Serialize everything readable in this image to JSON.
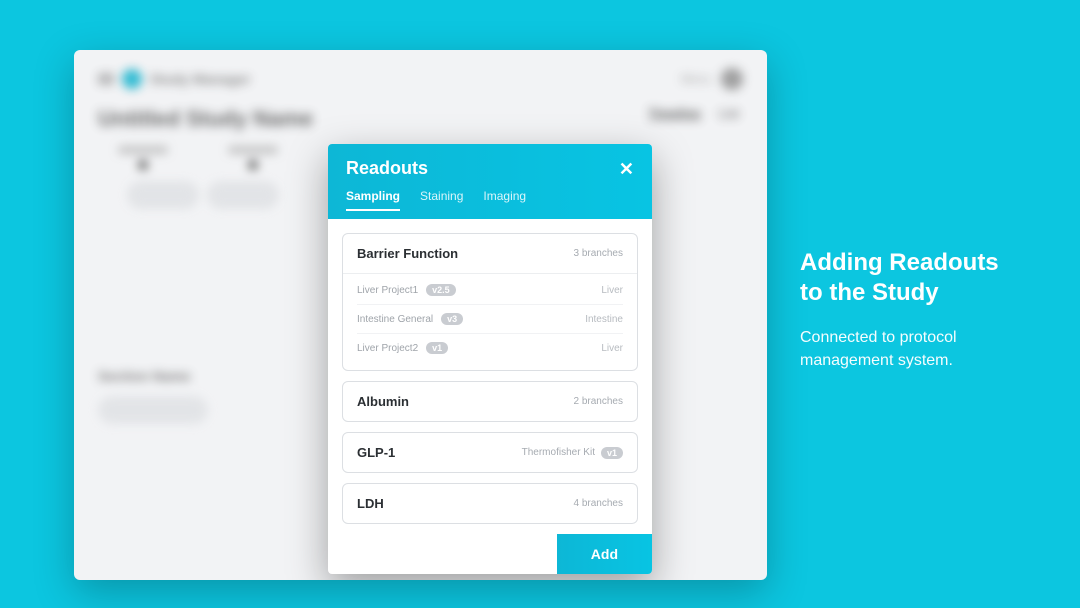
{
  "bg": {
    "app_title": "Study Manager",
    "menu_label": "Menu",
    "h1": "Untitled Study Name",
    "tab_active": "Timeline",
    "tab_other": "List",
    "section_a": "Section Name",
    "section_b": "Start Date"
  },
  "modal": {
    "title": "Readouts",
    "tabs": {
      "sampling": "Sampling",
      "staining": "Staining",
      "imaging": "Imaging"
    },
    "items": [
      {
        "name": "Barrier Function",
        "meta": "3 branches",
        "expanded": true,
        "branches": [
          {
            "name": "Liver Project1",
            "version": "v2.5",
            "tag": "Liver"
          },
          {
            "name": "Intestine General",
            "version": "v3",
            "tag": "Intestine"
          },
          {
            "name": "Liver Project2",
            "version": "v1",
            "tag": "Liver"
          }
        ]
      },
      {
        "name": "Albumin",
        "meta": "2 branches",
        "expanded": false
      },
      {
        "name": "GLP-1",
        "kit": "Thermofisher Kit",
        "version": "v1",
        "expanded": false
      },
      {
        "name": "LDH",
        "meta": "4 branches",
        "expanded": false
      }
    ],
    "add": "Add"
  },
  "side": {
    "title_l1": "Adding Readouts",
    "title_l2": "to the Study",
    "sub": "Connected to protocol management system."
  }
}
